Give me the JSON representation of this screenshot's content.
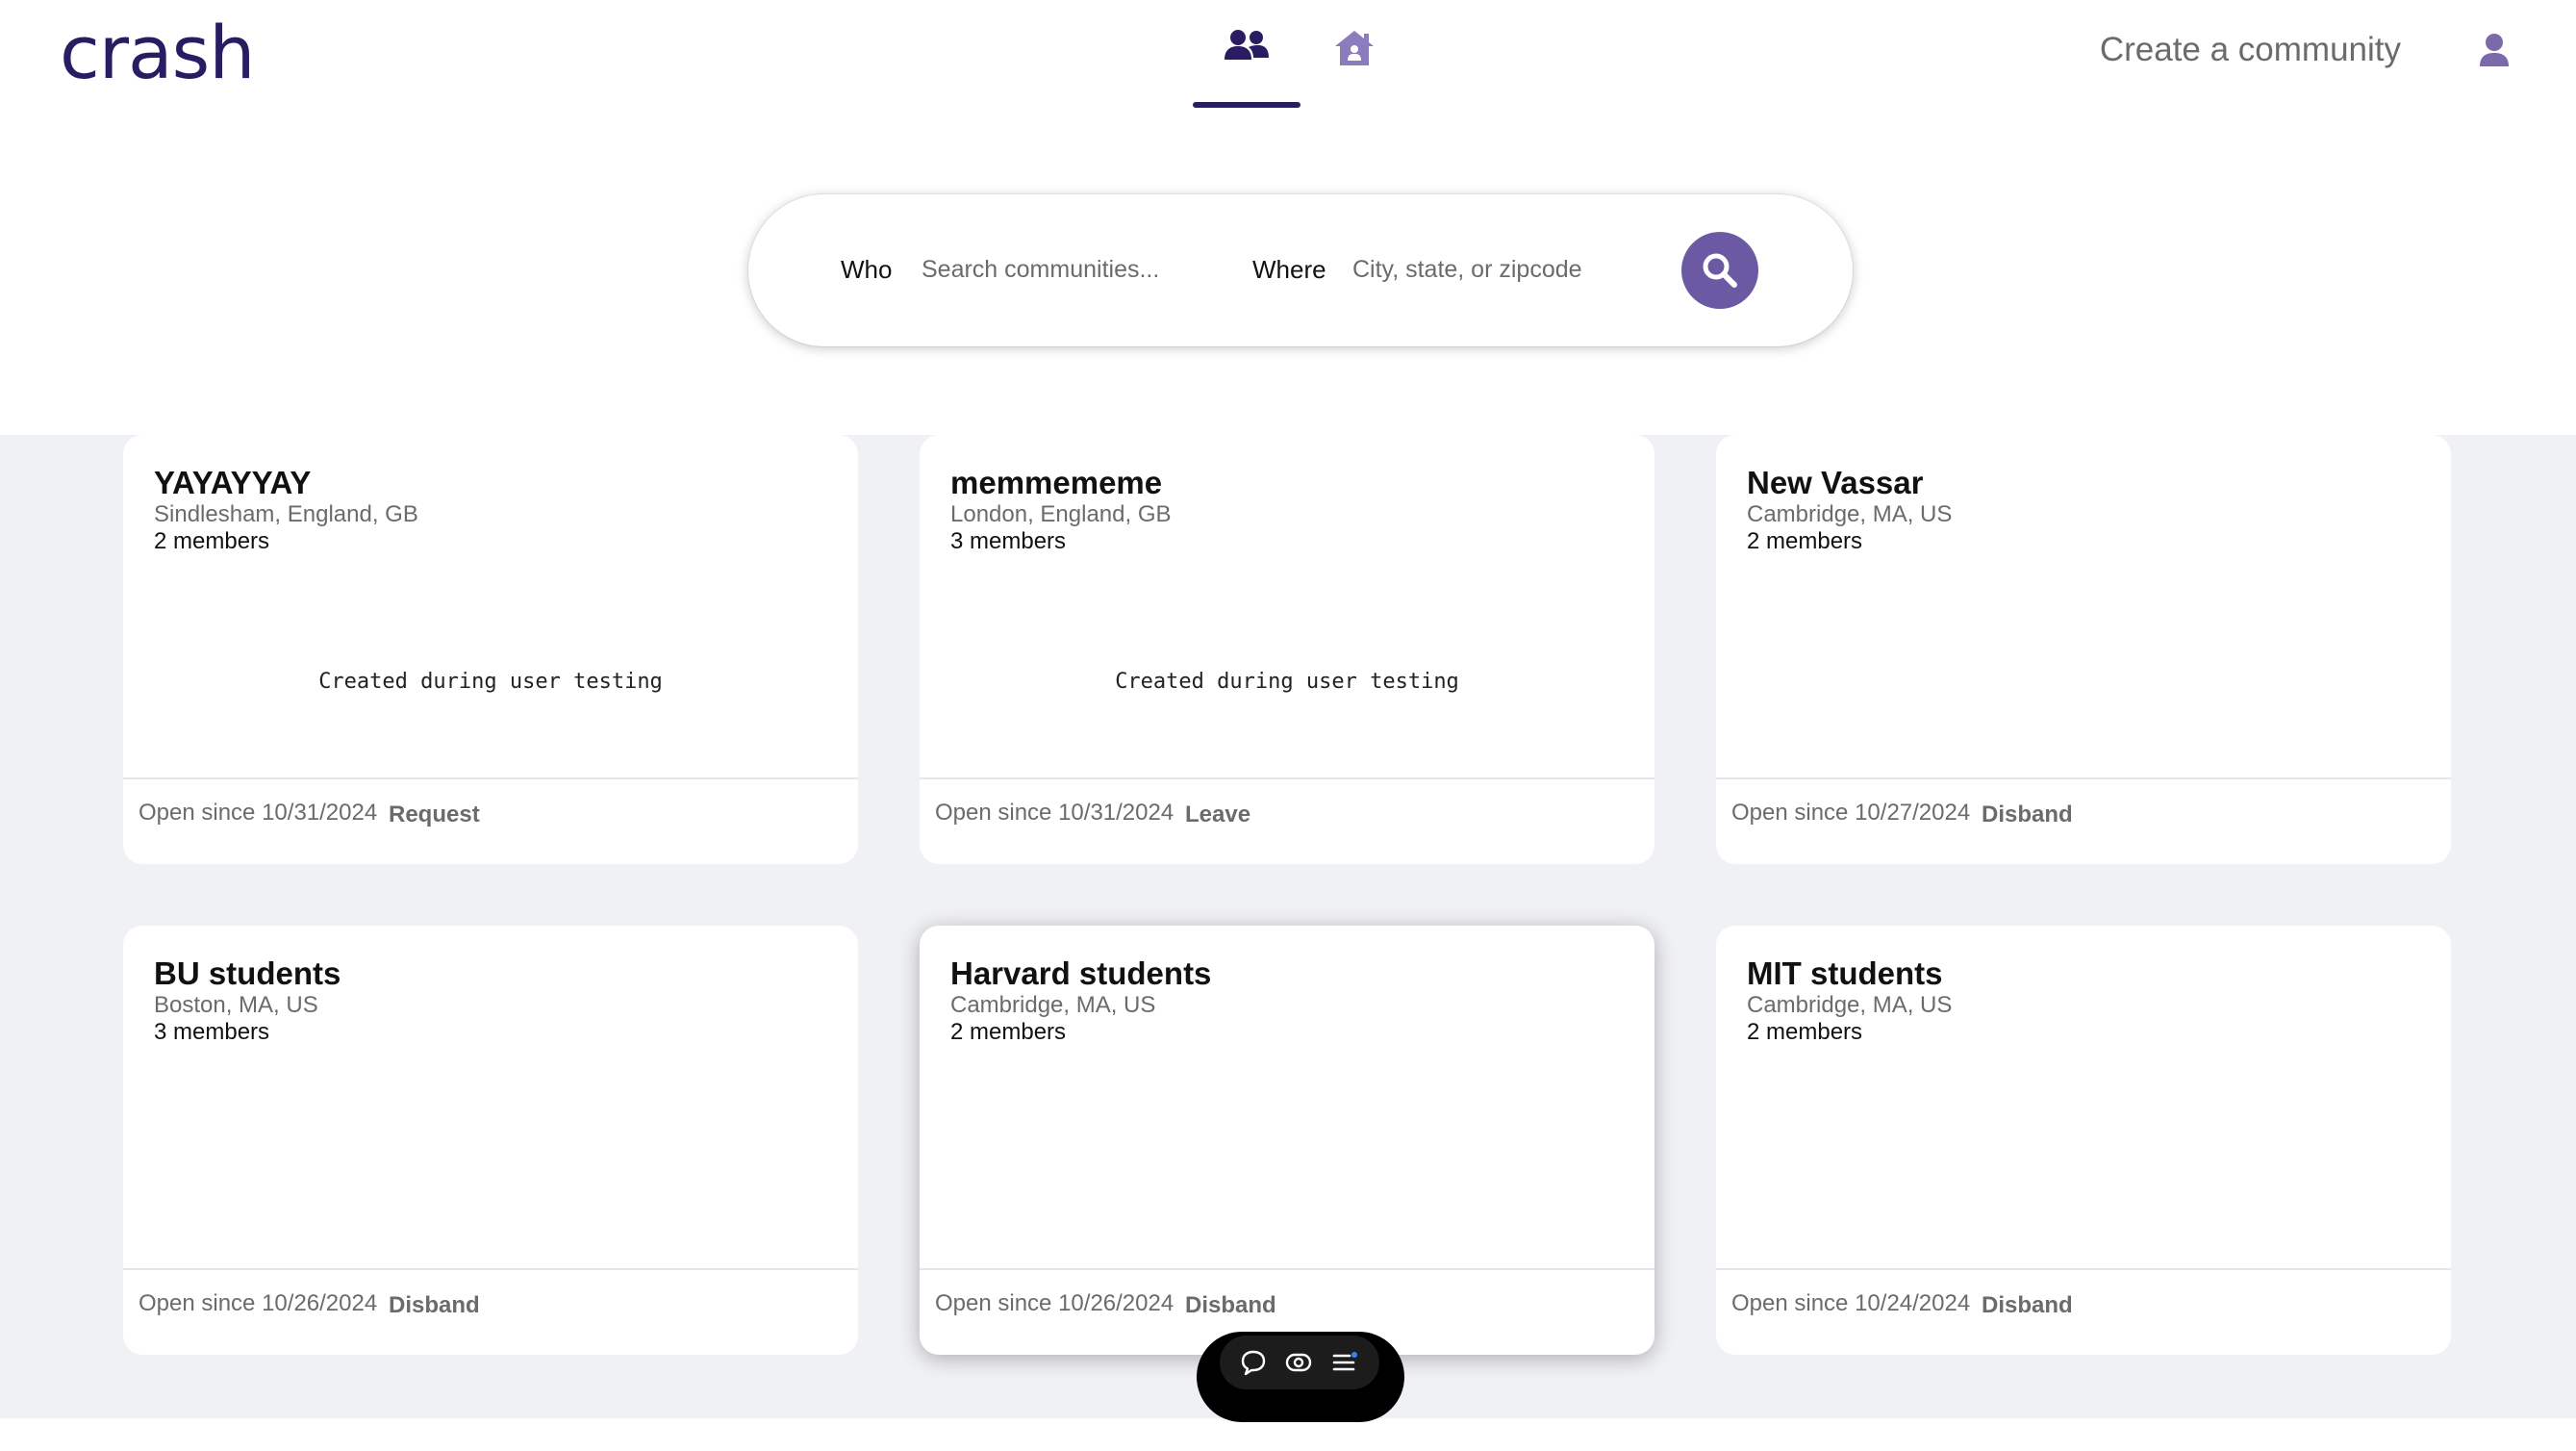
{
  "app": {
    "logo": "crash"
  },
  "header": {
    "tabs": [
      {
        "name": "communities",
        "icon": "people-icon",
        "active": true
      },
      {
        "name": "home",
        "icon": "home-icon",
        "active": false
      }
    ],
    "create_link": "Create a community",
    "profile_icon": "user-icon"
  },
  "search": {
    "who_label": "Who",
    "who_placeholder": "Search communities...",
    "where_label": "Where",
    "where_placeholder": "City, state, or zipcode",
    "button_icon": "search-icon"
  },
  "cards": [
    {
      "title": "YAYAYYAY",
      "location": "Sindlesham, England, GB",
      "members": "2 members",
      "description": "Created during user testing",
      "open_since": "Open since 10/31/2024",
      "action": "Request"
    },
    {
      "title": "memmememe",
      "location": "London, England, GB",
      "members": "3 members",
      "description": "Created during user testing",
      "open_since": "Open since 10/31/2024",
      "action": "Leave"
    },
    {
      "title": "New Vassar",
      "location": "Cambridge, MA, US",
      "members": "2 members",
      "description": "",
      "open_since": "Open since 10/27/2024",
      "action": "Disband"
    },
    {
      "title": "BU students",
      "location": "Boston, MA, US",
      "members": "3 members",
      "description": "",
      "open_since": "Open since 10/26/2024",
      "action": "Disband"
    },
    {
      "title": "Harvard students",
      "location": "Cambridge, MA, US",
      "members": "2 members",
      "description": "",
      "open_since": "Open since 10/26/2024",
      "action": "Disband"
    },
    {
      "title": "MIT students",
      "location": "Cambridge, MA, US",
      "members": "2 members",
      "description": "",
      "open_since": "Open since 10/24/2024",
      "action": "Disband"
    }
  ],
  "floating_toolbar": {
    "icons": [
      "comment-icon",
      "eye-icon",
      "list-icon"
    ]
  },
  "colors": {
    "brand": "#2a1c63",
    "accent": "#6b5aa3",
    "muted": "#6b6b6b",
    "background": "#f0f1f5"
  }
}
